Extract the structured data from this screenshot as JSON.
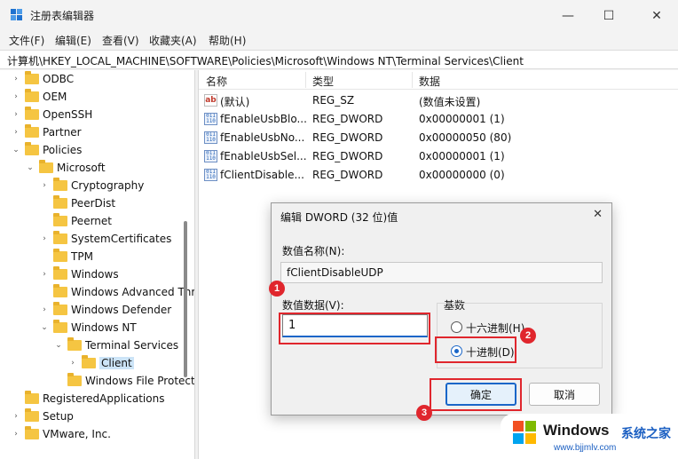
{
  "window": {
    "title": "注册表编辑器"
  },
  "controls": {
    "minimize": "—",
    "maximize": "☐",
    "close": "✕"
  },
  "menu": [
    "文件(F)",
    "编辑(E)",
    "查看(V)",
    "收藏夹(A)",
    "帮助(H)"
  ],
  "address": "计算机\\HKEY_LOCAL_MACHINE\\SOFTWARE\\Policies\\Microsoft\\Windows NT\\Terminal Services\\Client",
  "tree": [
    {
      "label": "ODBC",
      "depth": 1,
      "chevron": ">"
    },
    {
      "label": "OEM",
      "depth": 1,
      "chevron": ">"
    },
    {
      "label": "OpenSSH",
      "depth": 1,
      "chevron": ">"
    },
    {
      "label": "Partner",
      "depth": 1,
      "chevron": ">"
    },
    {
      "label": "Policies",
      "depth": 1,
      "chevron": "v"
    },
    {
      "label": "Microsoft",
      "depth": 2,
      "chevron": "v"
    },
    {
      "label": "Cryptography",
      "depth": 3,
      "chevron": ">"
    },
    {
      "label": "PeerDist",
      "depth": 3,
      "chevron": ""
    },
    {
      "label": "Peernet",
      "depth": 3,
      "chevron": ""
    },
    {
      "label": "SystemCertificates",
      "depth": 3,
      "chevron": ">"
    },
    {
      "label": "TPM",
      "depth": 3,
      "chevron": ""
    },
    {
      "label": "Windows",
      "depth": 3,
      "chevron": ">"
    },
    {
      "label": "Windows Advanced Threat Protection",
      "depth": 3,
      "chevron": ""
    },
    {
      "label": "Windows Defender",
      "depth": 3,
      "chevron": ">"
    },
    {
      "label": "Windows NT",
      "depth": 3,
      "chevron": "v"
    },
    {
      "label": "Terminal Services",
      "depth": 4,
      "chevron": "v"
    },
    {
      "label": "Client",
      "depth": 5,
      "chevron": ">",
      "selected": true
    },
    {
      "label": "Windows File Protection",
      "depth": 4,
      "chevron": ""
    },
    {
      "label": "RegisteredApplications",
      "depth": 1,
      "chevron": ""
    },
    {
      "label": "Setup",
      "depth": 1,
      "chevron": ">"
    },
    {
      "label": "VMware, Inc.",
      "depth": 1,
      "chevron": ">"
    }
  ],
  "list": {
    "headers": {
      "name": "名称",
      "type": "类型",
      "data": "数据"
    },
    "rows": [
      {
        "icon": "string-value-icon",
        "name": "(默认)",
        "type": "REG_SZ",
        "data": "(数值未设置)"
      },
      {
        "icon": "binary-value-icon",
        "name": "fEnableUsbBlo...",
        "type": "REG_DWORD",
        "data": "0x00000001 (1)"
      },
      {
        "icon": "binary-value-icon",
        "name": "fEnableUsbNo...",
        "type": "REG_DWORD",
        "data": "0x00000050 (80)"
      },
      {
        "icon": "binary-value-icon",
        "name": "fEnableUsbSel...",
        "type": "REG_DWORD",
        "data": "0x00000001 (1)"
      },
      {
        "icon": "binary-value-icon",
        "name": "fClientDisable...",
        "type": "REG_DWORD",
        "data": "0x00000000 (0)"
      }
    ]
  },
  "dialog": {
    "title": "编辑 DWORD (32 位)值",
    "close": "✕",
    "name_label": "数值名称(N):",
    "name_value": "fClientDisableUDP",
    "data_label": "数值数据(V):",
    "data_value": "1",
    "base_label": "基数",
    "radio_hex": "十六进制(H)",
    "radio_dec": "十进制(D)",
    "ok": "确定",
    "cancel": "取消"
  },
  "badges": [
    "1",
    "2",
    "3"
  ],
  "watermark": {
    "brand": "Windows",
    "cn": "系统之家",
    "url": "www.bjjmlv.com"
  },
  "colors": {
    "accent": "#1a66c8",
    "annotation": "#e0262d",
    "folder": "#f5c542",
    "selection": "#cce4f7"
  }
}
